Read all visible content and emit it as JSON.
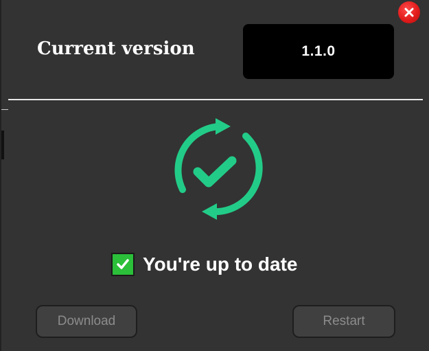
{
  "header": {
    "title": "Current version",
    "version": "1.1.0"
  },
  "status": {
    "text": "You're up to date",
    "icon": "sync-check-icon",
    "checked": true
  },
  "buttons": {
    "download_label": "Download",
    "restart_label": "Restart"
  },
  "colors": {
    "background": "#333333",
    "accent_green": "#22cc88",
    "checkbox_green": "#2bbf3a",
    "close_red": "#e21b1b",
    "version_box": "#000000",
    "button_text_disabled": "#8c8c8c"
  }
}
